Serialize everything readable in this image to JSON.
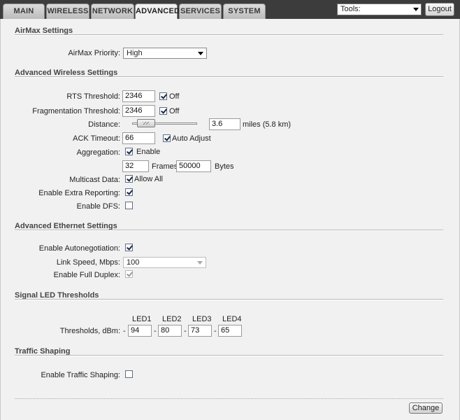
{
  "nav": {
    "tabs": [
      {
        "label": "MAIN"
      },
      {
        "label": "WIRELESS"
      },
      {
        "label": "NETWORK"
      },
      {
        "label": "ADVANCED",
        "active": true
      },
      {
        "label": "SERVICES"
      },
      {
        "label": "SYSTEM"
      }
    ],
    "tools_label": "Tools:",
    "logout_label": "Logout"
  },
  "airmax": {
    "title": "AirMax Settings",
    "priority_label": "AirMax Priority:",
    "priority_value": "High"
  },
  "wireless": {
    "title": "Advanced Wireless Settings",
    "rts_label": "RTS Threshold:",
    "rts_value": "2346",
    "rts_off_checked": true,
    "rts_off_label": "Off",
    "frag_label": "Fragmentation Threshold:",
    "frag_value": "2346",
    "frag_off_checked": true,
    "frag_off_label": "Off",
    "distance_label": "Distance:",
    "distance_value": "3.6",
    "distance_unit": "miles (5.8 km)",
    "ack_label": "ACK Timeout:",
    "ack_value": "66",
    "ack_auto_checked": true,
    "ack_auto_label": "Auto Adjust",
    "aggregation_label": "Aggregation:",
    "aggregation_checked": true,
    "aggregation_enable_label": "Enable",
    "frames_value": "32",
    "frames_label": "Frames",
    "bytes_value": "50000",
    "bytes_label": "Bytes",
    "multicast_label": "Multicast Data:",
    "multicast_checked": true,
    "multicast_allow_label": "Allow All",
    "extra_reporting_label": "Enable Extra Reporting:",
    "extra_reporting_checked": true,
    "dfs_label": "Enable DFS:",
    "dfs_checked": false
  },
  "ethernet": {
    "title": "Advanced Ethernet Settings",
    "autoneg_label": "Enable Autonegotiation:",
    "autoneg_checked": true,
    "link_speed_label": "Link Speed, Mbps:",
    "link_speed_value": "100",
    "full_duplex_label": "Enable Full Duplex:",
    "full_duplex_checked": true
  },
  "led": {
    "title": "Signal LED Thresholds",
    "thresholds_label": "Thresholds, dBm:",
    "dash": "-",
    "leds": [
      {
        "name": "LED1",
        "value": "94"
      },
      {
        "name": "LED2",
        "value": "80"
      },
      {
        "name": "LED3",
        "value": "73"
      },
      {
        "name": "LED4",
        "value": "65"
      }
    ]
  },
  "traffic": {
    "title": "Traffic Shaping",
    "enable_label": "Enable Traffic Shaping:",
    "enable_checked": false
  },
  "footer": {
    "change_label": "Change"
  }
}
